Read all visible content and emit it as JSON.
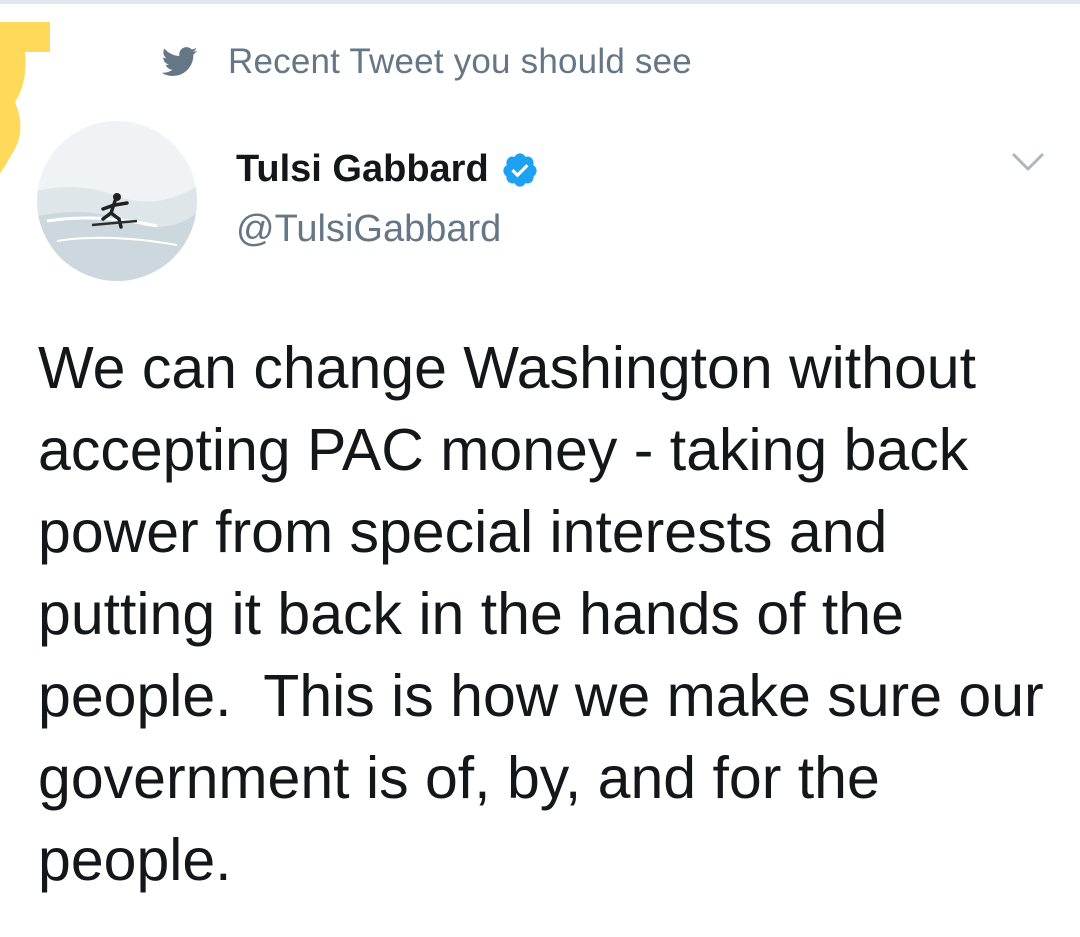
{
  "context": {
    "label": "Recent Tweet you should see",
    "icon": "twitter-bird-icon"
  },
  "author": {
    "name": "Tulsi Gabbard",
    "handle": "@TulsiGabbard",
    "verified_icon": "verified-badge-icon",
    "avatar": "surfer-avatar"
  },
  "menu": {
    "icon": "chevron-down-icon"
  },
  "tweet": {
    "text": "We can change Washington without accepting PAC money - taking back power from special interests and putting it back in the hands of the people.  This is how we make sure our government is of, by, and for the people."
  },
  "colors": {
    "accent": "#1da1f2",
    "secondary_text": "#657786",
    "primary_text": "#14171a",
    "highlight": "#ffd95a"
  }
}
